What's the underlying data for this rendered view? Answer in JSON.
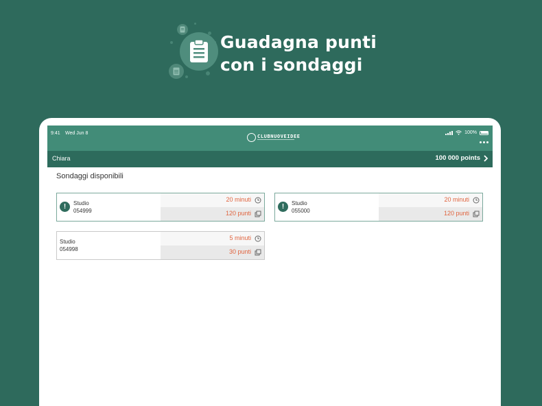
{
  "promo": {
    "headline_line1": "Guadagna punti",
    "headline_line2": "con i sondaggi"
  },
  "status_bar": {
    "time": "9:41",
    "date": "Wed Jun 8",
    "battery": "100%",
    "logo_text": "CLUBNUOVEIDEE"
  },
  "user_bar": {
    "name": "Chiara",
    "points": "100 000 points"
  },
  "section_title": "Sondaggi disponibili",
  "surveys": [
    {
      "label": "Studio",
      "code": "054999",
      "duration": "20 minuti",
      "reward": "120 punti",
      "alert": true
    },
    {
      "label": "Studio",
      "code": "055000",
      "duration": "20 minuti",
      "reward": "120 punti",
      "alert": true
    },
    {
      "label": "Studio",
      "code": "054998",
      "duration": "5 minuti",
      "reward": "30 punti",
      "alert": false
    }
  ],
  "colors": {
    "background": "#2e6a5c",
    "status_bar": "#428c78",
    "user_bar": "#2d6b5c",
    "accent_orange": "#e0643f"
  },
  "icons": {
    "promo": "clipboard-icon",
    "duration": "clock-icon",
    "reward": "coins-icon",
    "alert": "exclamation-icon"
  }
}
